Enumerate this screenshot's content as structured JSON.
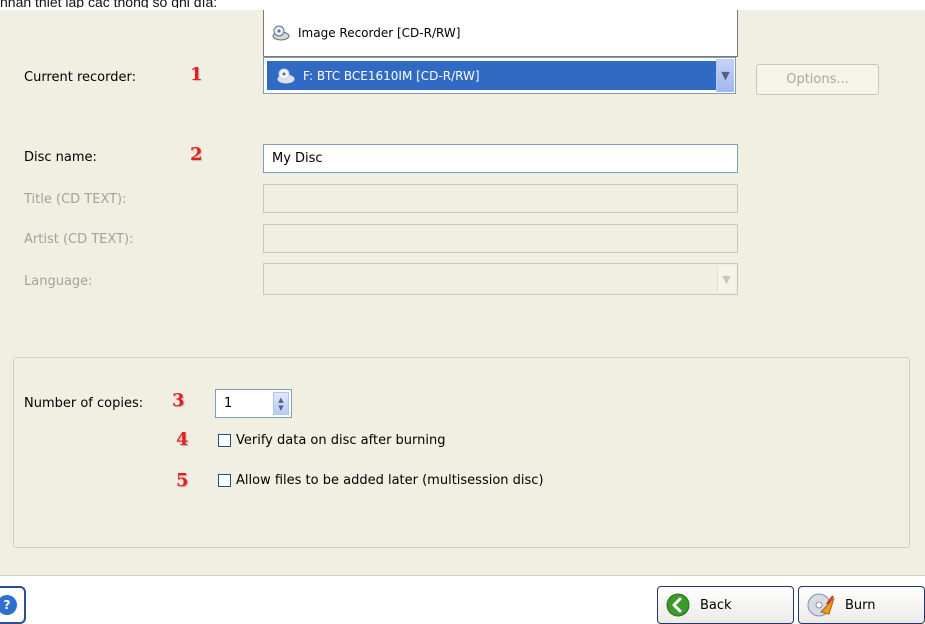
{
  "caption": "nhận thiết lập các thông số ghi đĩa:",
  "recorder": {
    "label": "Current recorder:",
    "popup_option": "Image Recorder  [CD-R/RW]",
    "selected": "F: BTC BCE1610IM  [CD-R/RW]",
    "options_button": "Options..."
  },
  "disc": {
    "name_label": "Disc name:",
    "name_value": "My Disc",
    "title_label": "Title (CD TEXT):",
    "title_value": "",
    "artist_label": "Artist (CD TEXT):",
    "artist_value": "",
    "language_label": "Language:",
    "language_value": ""
  },
  "copies": {
    "label": "Number of copies:",
    "value": "1"
  },
  "checkboxes": [
    {
      "label": "Verify data on disc after burning",
      "checked": false
    },
    {
      "label": "Allow files to be added later (multisession disc)",
      "checked": false
    }
  ],
  "markers": [
    "1",
    "2",
    "3",
    "4",
    "5"
  ],
  "footer": {
    "back_label": "Back",
    "burn_label": "Burn"
  },
  "icons": {
    "recorder": "disc-drive-icon",
    "help": "help-icon",
    "back": "back-arrow-icon",
    "burn": "burn-disc-icon"
  },
  "colors": {
    "panel": "#f1efe2",
    "selection": "#316ac5",
    "marker": "#e02020",
    "disabled_text": "#a4a09a"
  }
}
